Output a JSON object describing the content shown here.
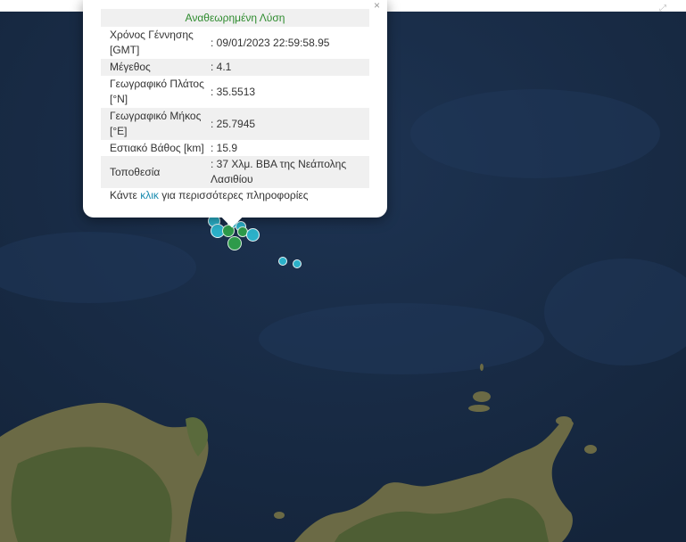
{
  "map": {
    "colors": {
      "sea": "#1a2d47",
      "land": "#6b6a45",
      "land_dark": "#4e5e34",
      "marker_teal": "#2bb0c8",
      "marker_green": "#2e9a4a"
    },
    "markers": [
      {
        "type": "teal"
      },
      {
        "type": "teal"
      },
      {
        "type": "teal"
      },
      {
        "type": "teal"
      },
      {
        "type": "green"
      },
      {
        "type": "green"
      },
      {
        "type": "green"
      },
      {
        "type": "teal"
      },
      {
        "type": "teal"
      },
      {
        "type": "teal"
      }
    ]
  },
  "popup": {
    "title": "Αναθεωρημένη Λύση",
    "rows": [
      {
        "label": "Χρόνος Γέννησης [GMT]",
        "value": ": 09/01/2023 22:59:58.95"
      },
      {
        "label": "Μέγεθος",
        "value": ": 4.1"
      },
      {
        "label": "Γεωγραφικό Πλάτος [°N]",
        "value": ": 35.5513"
      },
      {
        "label": "Γεωγραφικό Μήκος [°E]",
        "value": ": 25.7945"
      },
      {
        "label": "Εστιακό Βάθος [km]",
        "value": ": 15.9"
      },
      {
        "label": "Τοποθεσία",
        "value": ": 37 Χλμ. ΒΒΑ της Νεάπολης Λασιθίου"
      }
    ],
    "more_prefix": "Κάντε ",
    "more_link": "κλικ",
    "more_suffix": " για περισσότερες πληροφορίες",
    "close_icon": "close-icon"
  }
}
